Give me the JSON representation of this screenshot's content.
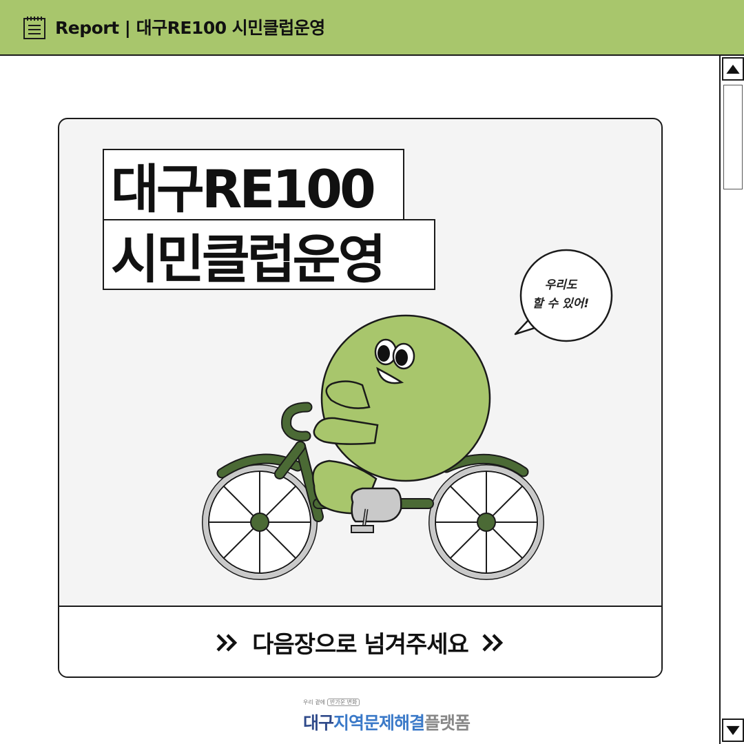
{
  "header": {
    "title": "Report | 대구RE100 시민클럽운영",
    "icon": "document-icon",
    "background": "#a8c66c"
  },
  "card": {
    "title_line1": "대구RE100",
    "title_line2": "시민클럽운영",
    "speech_bubble": [
      "우리도",
      "할 수 있어!"
    ],
    "next_page_label": "다음장으로 넘겨주세요",
    "character_color": "#a8c66c",
    "bicycle_color": "#4b6a35"
  },
  "logo": {
    "tagline_prefix": "우리 곁에",
    "tagline_boxed": "반가운 변화",
    "name_part1": "대구",
    "name_part2": "지역문제해결",
    "name_part3": "플랫폼"
  },
  "scrollbar": {
    "up_icon": "arrow-up-icon",
    "down_icon": "arrow-down-icon"
  }
}
